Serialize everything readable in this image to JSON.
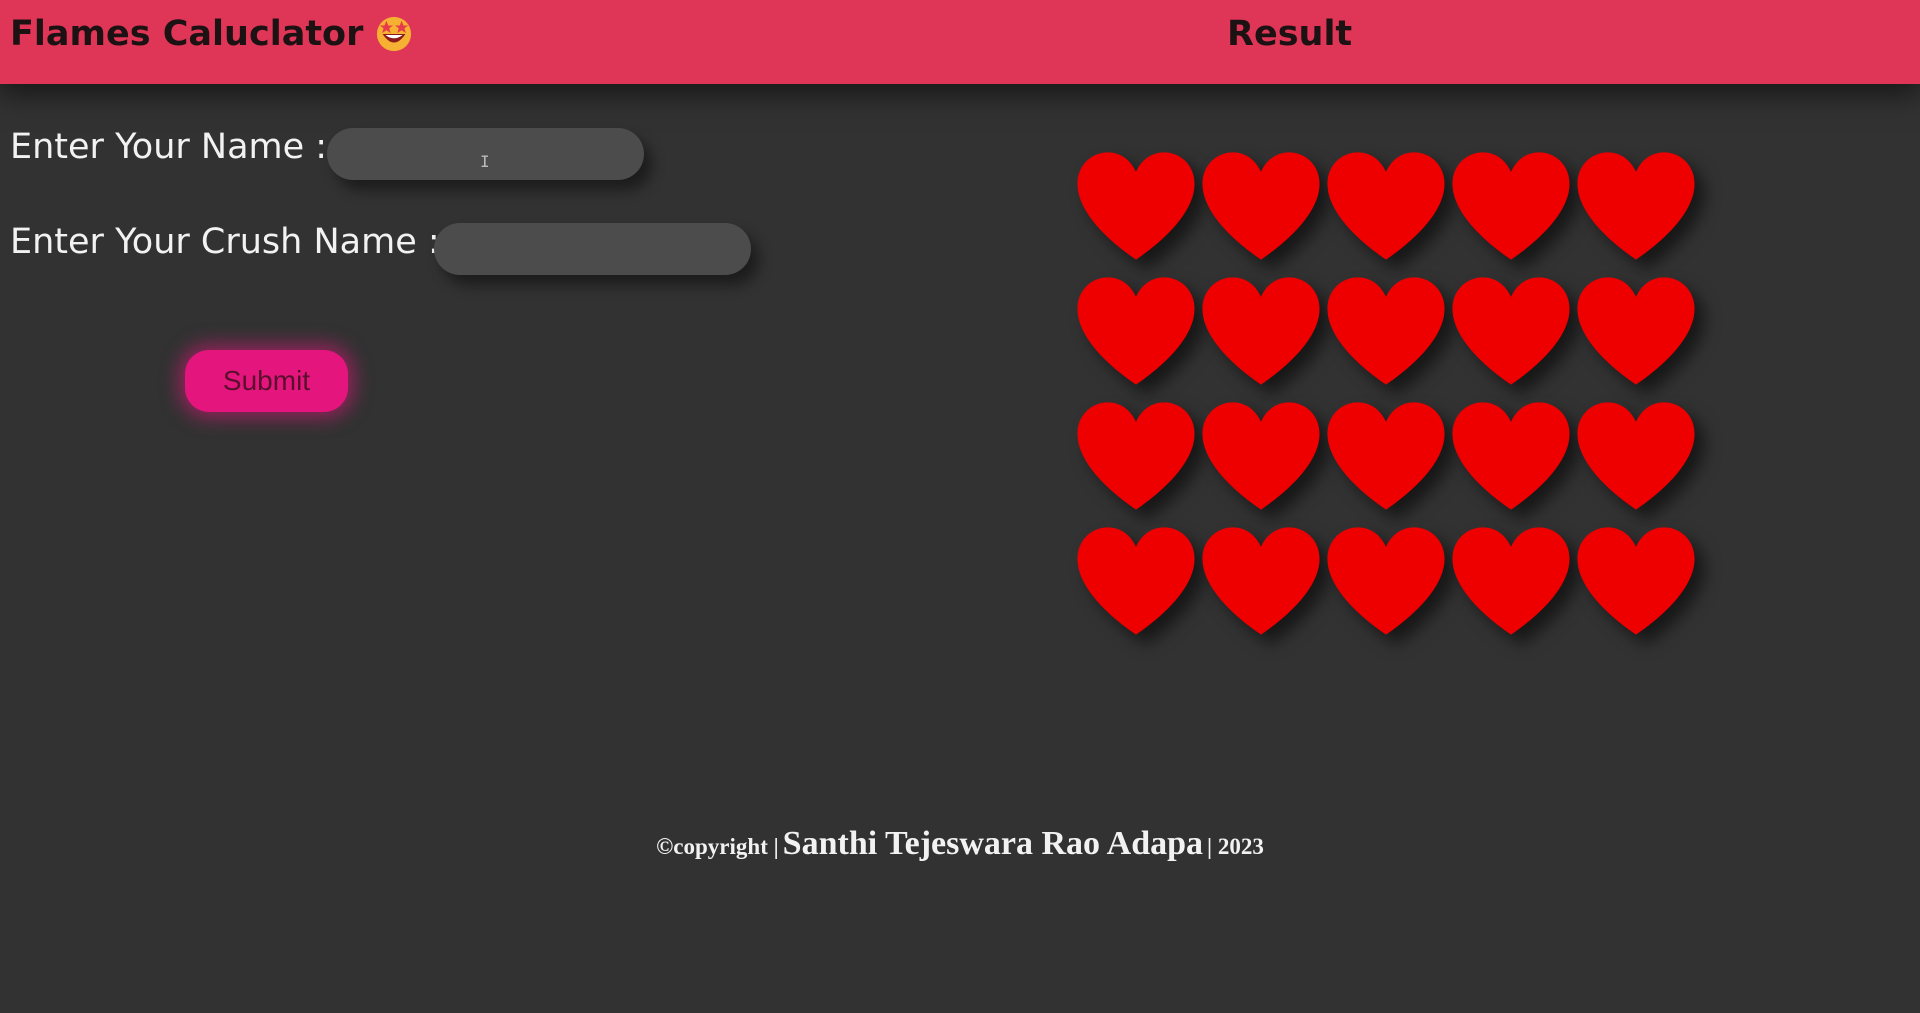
{
  "header": {
    "app_title": "Flames Caluclator",
    "result_title": "Result",
    "title_emoji": "star-struck-emoji"
  },
  "form": {
    "name_label": "Enter Your Name :",
    "name_value": "",
    "crush_label": "Enter Your Crush Name :",
    "crush_value": "",
    "submit_label": "Submit"
  },
  "hearts": {
    "icon": "heart-icon",
    "rows": 4,
    "columns": 5,
    "color": "#ee0000"
  },
  "footer": {
    "copyright": "©copyright |",
    "author": "Santhi Tejeswara Rao Adapa",
    "year": "| 2023"
  },
  "colors": {
    "header_bg": "#df3657",
    "page_bg": "#323232",
    "submit_bg": "#e4157c"
  }
}
